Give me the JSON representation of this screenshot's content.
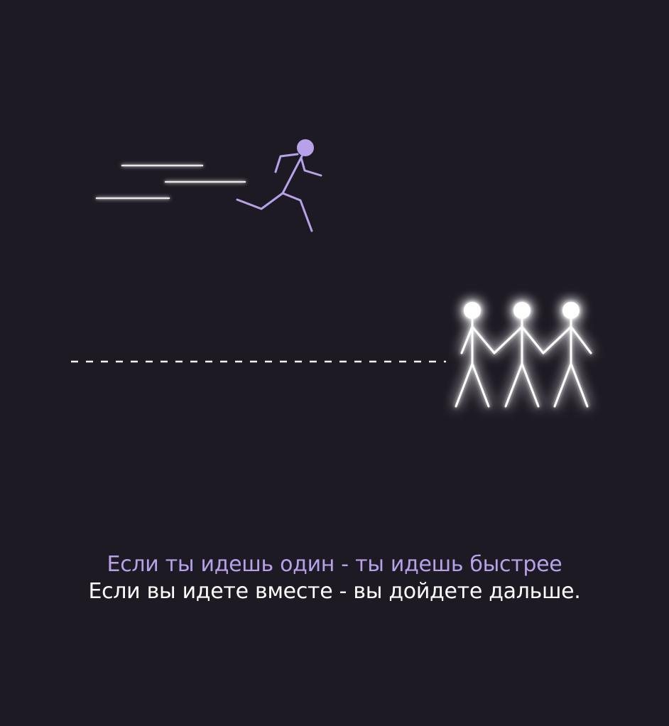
{
  "colors": {
    "background": "#1e1a24",
    "accent_lavender": "#b7a2ea",
    "white": "#ffffff"
  },
  "illustration": {
    "solo_runner_icon": "running-stick-figure-icon",
    "group_icon": "three-stick-figures-holding-hands-icon",
    "speed_lines_icon": "motion-lines-icon",
    "path_icon": "dashed-line-icon"
  },
  "caption": {
    "line_1": "Если ты идешь один - ты идешь быстрее",
    "line_2": "Если вы идете вместе - вы дойдете дальше."
  }
}
